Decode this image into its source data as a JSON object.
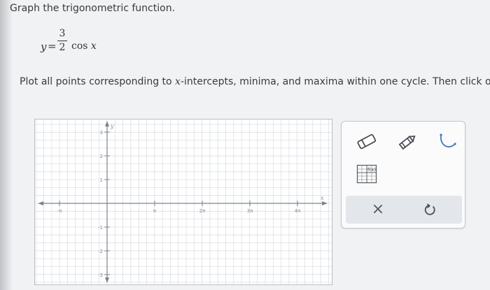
{
  "question": {
    "prompt": "Graph the trigonometric function.",
    "equation": {
      "lhs": "y",
      "equals": "=",
      "numerator": "3",
      "denominator": "2",
      "function": "cos",
      "variable": "x"
    },
    "instruction": {
      "before": "Plot all points corresponding to ",
      "variable": "x",
      "after": "-intercepts, minima, and maxima within one cycle. Then click on"
    }
  },
  "graph": {
    "x_ticks": [
      {
        "value": -1,
        "label": "-π"
      },
      {
        "value": 1,
        "label": "π"
      },
      {
        "value": 2,
        "label": "2π"
      },
      {
        "value": 3,
        "label": "3π"
      },
      {
        "value": 4,
        "label": "4π"
      }
    ],
    "y_ticks": [
      {
        "value": 3,
        "label": "3"
      },
      {
        "value": 2,
        "label": "2"
      },
      {
        "value": 1,
        "label": "1"
      },
      {
        "value": -1,
        "label": "-1"
      },
      {
        "value": -2,
        "label": "-2"
      },
      {
        "value": -3,
        "label": "-3"
      }
    ],
    "x_axis_label": "x",
    "y_axis_label": "y",
    "colors": {
      "grid": "#dcdfe3",
      "axis": "#7f8489",
      "tick_label": "#8a8f94",
      "background": "#ffffff"
    }
  },
  "tools": {
    "eraser": {
      "icon": "eraser-icon"
    },
    "pencil": {
      "icon": "pencil-icon"
    },
    "curve": {
      "icon": "curve-tool-icon"
    },
    "table": {
      "icon": "table-grid-icon"
    },
    "clear": {
      "icon": "close-icon",
      "glyph": "×"
    },
    "reset": {
      "icon": "undo-icon"
    }
  }
}
